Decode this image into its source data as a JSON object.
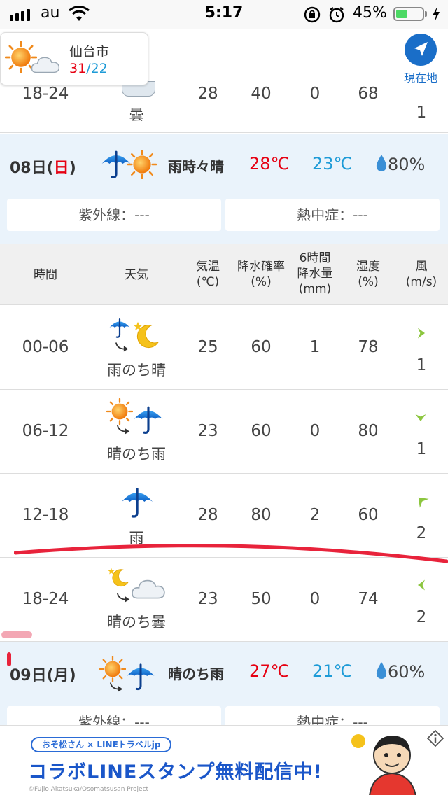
{
  "status_bar": {
    "carrier": "au",
    "time": "5:17",
    "battery": "45%",
    "battery_level": 0.45
  },
  "top": {
    "city": "仙台市",
    "high": "31",
    "sep": "/",
    "low": "22",
    "location_label": "現在地"
  },
  "prev_row": {
    "time": "18-24",
    "weather": "曇",
    "temp": "28",
    "prob": "40",
    "amount": "0",
    "humidity": "68",
    "wind_speed": "1"
  },
  "day8": {
    "date_num": "08日(",
    "weekday": "日",
    "date_close": ")",
    "weather": "雨時々晴",
    "high": "28℃",
    "low": "23℃",
    "rain": "80%",
    "uv": "紫外線：---",
    "heat": "熱中症：---"
  },
  "table_header": {
    "time": "時間",
    "weather": "天気",
    "temp_1": "気温",
    "temp_2": "(℃)",
    "prob_1": "降水確率",
    "prob_2": "(%)",
    "amt_1": "6時間",
    "amt_2": "降水量",
    "amt_3": "(mm)",
    "hum_1": "湿度",
    "hum_2": "(%)",
    "wind_1": "風",
    "wind_2": "(m/s)"
  },
  "rows": [
    {
      "time": "00-06",
      "weather": "雨のち晴",
      "temp": "25",
      "prob": "60",
      "amount": "1",
      "humidity": "78",
      "wind_speed": "1",
      "icon": "rain-then-moon-icon",
      "wind_dir": "east"
    },
    {
      "time": "06-12",
      "weather": "晴のち雨",
      "temp": "23",
      "prob": "60",
      "amount": "0",
      "humidity": "80",
      "wind_speed": "1",
      "icon": "sun-then-rain-icon",
      "wind_dir": "south"
    },
    {
      "time": "12-18",
      "weather": "雨",
      "temp": "28",
      "prob": "80",
      "amount": "2",
      "humidity": "60",
      "wind_speed": "2",
      "icon": "umbrella-icon",
      "wind_dir": "north-east"
    },
    {
      "time": "18-24",
      "weather": "晴のち曇",
      "temp": "23",
      "prob": "50",
      "amount": "0",
      "humidity": "74",
      "wind_speed": "2",
      "icon": "moon-then-cloud-icon",
      "wind_dir": "west"
    }
  ],
  "day9": {
    "date": "09日(月)",
    "weather": "晴のち雨",
    "high": "27℃",
    "low": "21℃",
    "rain": "60%",
    "uv": "紫外線：---",
    "heat": "熱中症：---"
  },
  "ad": {
    "pill": "おそ松さん × LINEトラベルjp",
    "headline": "コラボLINEスタンプ無料配信中!",
    "copy": "©Fujio Akatsuka/Osomatsusan Project"
  },
  "colors": {
    "high": "#e60012",
    "low": "#1e9bd7",
    "accent": "#1a6ec8",
    "wind_arrow": "#8cc63f"
  }
}
